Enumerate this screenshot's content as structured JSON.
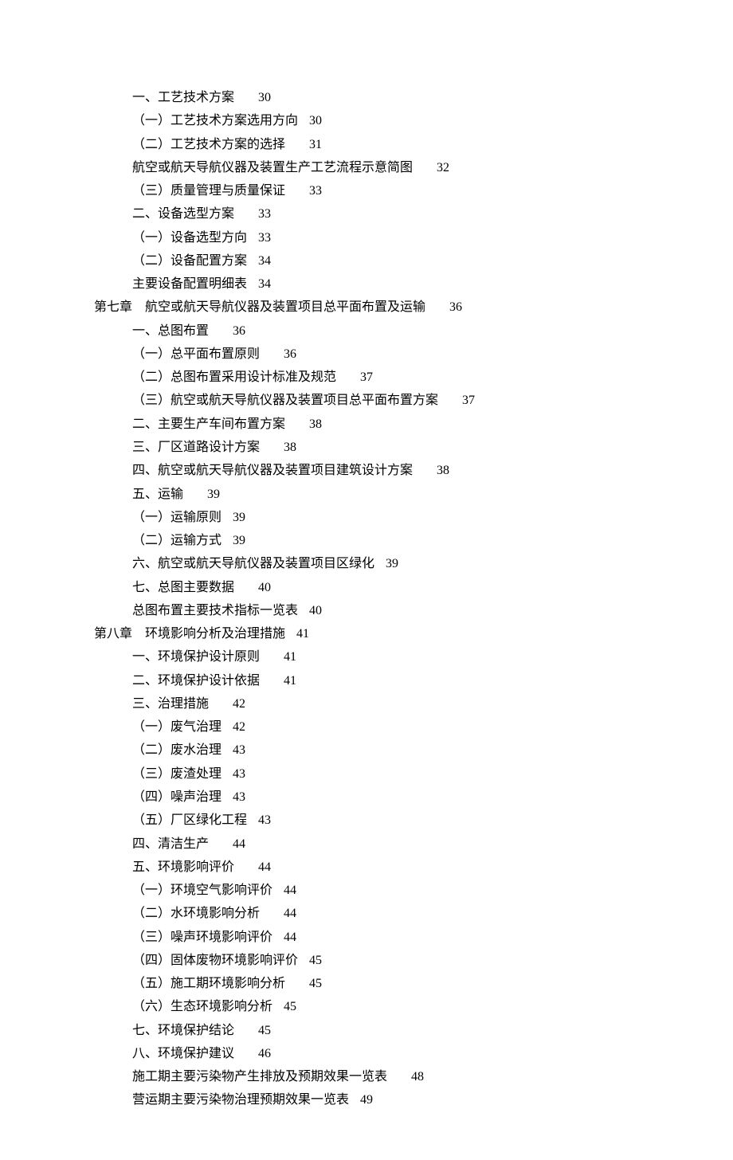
{
  "toc": [
    {
      "indent": 1,
      "title": "一、工艺技术方案",
      "gap": 30,
      "page": "30"
    },
    {
      "indent": 1,
      "title": "（一）工艺技术方案选用方向",
      "gap": 14,
      "page": "30"
    },
    {
      "indent": 1,
      "title": "（二）工艺技术方案的选择",
      "gap": 30,
      "page": "31"
    },
    {
      "indent": 1,
      "title": "航空或航天导航仪器及装置生产工艺流程示意简图",
      "gap": 30,
      "page": "32"
    },
    {
      "indent": 1,
      "title": "（三）质量管理与质量保证",
      "gap": 30,
      "page": "33"
    },
    {
      "indent": 1,
      "title": "二、设备选型方案",
      "gap": 30,
      "page": "33"
    },
    {
      "indent": 1,
      "title": "（一）设备选型方向",
      "gap": 14,
      "page": "33"
    },
    {
      "indent": 1,
      "title": "（二）设备配置方案",
      "gap": 14,
      "page": "34"
    },
    {
      "indent": 1,
      "title": "主要设备配置明细表",
      "gap": 14,
      "page": "34"
    },
    {
      "indent": 0,
      "title": "第七章　航空或航天导航仪器及装置项目总平面布置及运输",
      "gap": 30,
      "page": "36"
    },
    {
      "indent": 1,
      "title": "一、总图布置",
      "gap": 30,
      "page": "36"
    },
    {
      "indent": 1,
      "title": "（一）总平面布置原则",
      "gap": 30,
      "page": "36"
    },
    {
      "indent": 1,
      "title": "（二）总图布置采用设计标准及规范",
      "gap": 30,
      "page": "37"
    },
    {
      "indent": 1,
      "title": "（三）航空或航天导航仪器及装置项目总平面布置方案",
      "gap": 30,
      "page": "37"
    },
    {
      "indent": 1,
      "title": "二、主要生产车间布置方案",
      "gap": 30,
      "page": "38"
    },
    {
      "indent": 1,
      "title": "三、厂区道路设计方案",
      "gap": 30,
      "page": "38"
    },
    {
      "indent": 1,
      "title": "四、航空或航天导航仪器及装置项目建筑设计方案",
      "gap": 30,
      "page": "38"
    },
    {
      "indent": 1,
      "title": "五、运输",
      "gap": 30,
      "page": "39"
    },
    {
      "indent": 1,
      "title": "（一）运输原则",
      "gap": 14,
      "page": "39"
    },
    {
      "indent": 1,
      "title": "（二）运输方式",
      "gap": 14,
      "page": "39"
    },
    {
      "indent": 1,
      "title": "六、航空或航天导航仪器及装置项目区绿化",
      "gap": 14,
      "page": "39"
    },
    {
      "indent": 1,
      "title": "七、总图主要数据",
      "gap": 30,
      "page": "40"
    },
    {
      "indent": 1,
      "title": "总图布置主要技术指标一览表",
      "gap": 14,
      "page": "40"
    },
    {
      "indent": 0,
      "title": "第八章　环境影响分析及治理措施",
      "gap": 14,
      "page": "41"
    },
    {
      "indent": 1,
      "title": "一、环境保护设计原则",
      "gap": 30,
      "page": "41"
    },
    {
      "indent": 1,
      "title": "二、环境保护设计依据",
      "gap": 30,
      "page": "41"
    },
    {
      "indent": 1,
      "title": "三、治理措施",
      "gap": 30,
      "page": "42"
    },
    {
      "indent": 1,
      "title": "（一）废气治理",
      "gap": 14,
      "page": "42"
    },
    {
      "indent": 1,
      "title": "（二）废水治理",
      "gap": 14,
      "page": "43"
    },
    {
      "indent": 1,
      "title": "（三）废渣处理",
      "gap": 14,
      "page": "43"
    },
    {
      "indent": 1,
      "title": "（四）噪声治理",
      "gap": 14,
      "page": "43"
    },
    {
      "indent": 1,
      "title": "（五）厂区绿化工程",
      "gap": 14,
      "page": "43"
    },
    {
      "indent": 1,
      "title": "四、清洁生产",
      "gap": 30,
      "page": "44"
    },
    {
      "indent": 1,
      "title": "五、环境影响评价",
      "gap": 30,
      "page": "44"
    },
    {
      "indent": 1,
      "title": "（一）环境空气影响评价",
      "gap": 14,
      "page": "44"
    },
    {
      "indent": 1,
      "title": "（二）水环境影响分析",
      "gap": 30,
      "page": "44"
    },
    {
      "indent": 1,
      "title": "（三）噪声环境影响评价",
      "gap": 14,
      "page": "44"
    },
    {
      "indent": 1,
      "title": "（四）固体废物环境影响评价",
      "gap": 14,
      "page": "45"
    },
    {
      "indent": 1,
      "title": "（五）施工期环境影响分析",
      "gap": 30,
      "page": "45"
    },
    {
      "indent": 1,
      "title": "（六）生态环境影响分析",
      "gap": 14,
      "page": "45"
    },
    {
      "indent": 1,
      "title": "七、环境保护结论",
      "gap": 30,
      "page": "45"
    },
    {
      "indent": 1,
      "title": "八、环境保护建议",
      "gap": 30,
      "page": "46"
    },
    {
      "indent": 1,
      "title": "施工期主要污染物产生排放及预期效果一览表",
      "gap": 30,
      "page": "48"
    },
    {
      "indent": 1,
      "title": "营运期主要污染物治理预期效果一览表",
      "gap": 14,
      "page": "49"
    }
  ]
}
